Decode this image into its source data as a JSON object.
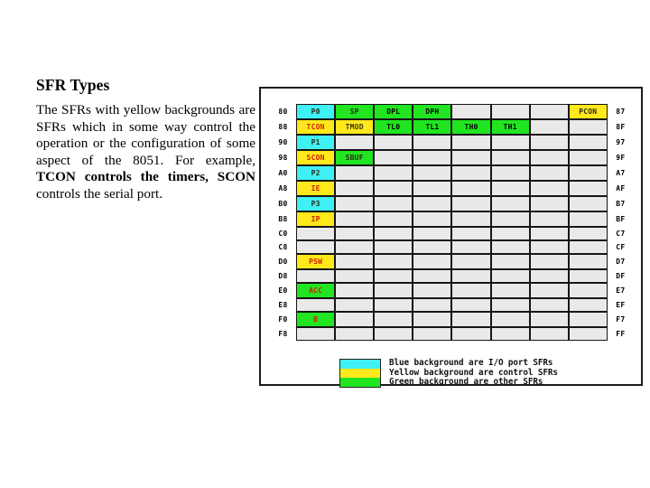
{
  "page_title": "SFR Types",
  "body_paragraph": {
    "segments": [
      {
        "text": "The SFRs with yellow backgrounds are SFRs which in some way control the operation or the configuration of some aspect of the 8051. For example, ",
        "bold": false
      },
      {
        "text": "TCON controls the timers, SCON",
        "bold": true
      },
      {
        "text": " controls the serial port.",
        "bold": false
      }
    ]
  },
  "figure": {
    "type": "table",
    "left_addresses": [
      "80",
      "88",
      "90",
      "98",
      "A0",
      "A8",
      "B0",
      "B8",
      "C0",
      "C8",
      "D0",
      "D8",
      "E0",
      "E8",
      "F0",
      "F8"
    ],
    "right_addresses": [
      "87",
      "8F",
      "97",
      "9F",
      "A7",
      "AF",
      "B7",
      "BF",
      "C7",
      "CF",
      "D7",
      "DF",
      "E7",
      "EF",
      "F7",
      "FF"
    ],
    "rows": [
      {
        "left": "80",
        "right": "87",
        "cells": [
          {
            "label": "P0",
            "color": "blue",
            "text_color": "dark"
          },
          {
            "label": "SP",
            "color": "green",
            "text_color": "dark"
          },
          {
            "label": "DPL",
            "color": "green",
            "text_color": "black"
          },
          {
            "label": "DPH",
            "color": "green",
            "text_color": "black"
          },
          {
            "label": "",
            "color": "empty",
            "text_color": "black"
          },
          {
            "label": "",
            "color": "empty",
            "text_color": "black"
          },
          {
            "label": "",
            "color": "empty",
            "text_color": "black"
          },
          {
            "label": "PCON",
            "color": "yellow",
            "text_color": "dark"
          }
        ]
      },
      {
        "left": "88",
        "right": "8F",
        "cells": [
          {
            "label": "TCON",
            "color": "yellow",
            "text_color": "red"
          },
          {
            "label": "TMOD",
            "color": "yellow",
            "text_color": "olive"
          },
          {
            "label": "TL0",
            "color": "green",
            "text_color": "black"
          },
          {
            "label": "TL1",
            "color": "green",
            "text_color": "black"
          },
          {
            "label": "TH0",
            "color": "green",
            "text_color": "black"
          },
          {
            "label": "TH1",
            "color": "green",
            "text_color": "black"
          },
          {
            "label": "",
            "color": "empty",
            "text_color": "black"
          },
          {
            "label": "",
            "color": "empty",
            "text_color": "black"
          }
        ]
      },
      {
        "left": "90",
        "right": "97",
        "cells": [
          {
            "label": "P1",
            "color": "blue",
            "text_color": "dark"
          },
          {
            "label": "",
            "color": "empty",
            "text_color": "black"
          },
          {
            "label": "",
            "color": "empty",
            "text_color": "black"
          },
          {
            "label": "",
            "color": "empty",
            "text_color": "black"
          },
          {
            "label": "",
            "color": "empty",
            "text_color": "black"
          },
          {
            "label": "",
            "color": "empty",
            "text_color": "black"
          },
          {
            "label": "",
            "color": "empty",
            "text_color": "black"
          },
          {
            "label": "",
            "color": "empty",
            "text_color": "black"
          }
        ]
      },
      {
        "left": "98",
        "right": "9F",
        "cells": [
          {
            "label": "SCON",
            "color": "yellow",
            "text_color": "red"
          },
          {
            "label": "SBUF",
            "color": "green",
            "text_color": "dark"
          },
          {
            "label": "",
            "color": "empty",
            "text_color": "black"
          },
          {
            "label": "",
            "color": "empty",
            "text_color": "black"
          },
          {
            "label": "",
            "color": "empty",
            "text_color": "black"
          },
          {
            "label": "",
            "color": "empty",
            "text_color": "black"
          },
          {
            "label": "",
            "color": "empty",
            "text_color": "black"
          },
          {
            "label": "",
            "color": "empty",
            "text_color": "black"
          }
        ]
      },
      {
        "left": "A0",
        "right": "A7",
        "cells": [
          {
            "label": "P2",
            "color": "blue",
            "text_color": "dark"
          },
          {
            "label": "",
            "color": "empty",
            "text_color": "black"
          },
          {
            "label": "",
            "color": "empty",
            "text_color": "black"
          },
          {
            "label": "",
            "color": "empty",
            "text_color": "black"
          },
          {
            "label": "",
            "color": "empty",
            "text_color": "black"
          },
          {
            "label": "",
            "color": "empty",
            "text_color": "black"
          },
          {
            "label": "",
            "color": "empty",
            "text_color": "black"
          },
          {
            "label": "",
            "color": "empty",
            "text_color": "black"
          }
        ]
      },
      {
        "left": "A8",
        "right": "AF",
        "cells": [
          {
            "label": "IE",
            "color": "yellow",
            "text_color": "red"
          },
          {
            "label": "",
            "color": "empty",
            "text_color": "black"
          },
          {
            "label": "",
            "color": "empty",
            "text_color": "black"
          },
          {
            "label": "",
            "color": "empty",
            "text_color": "black"
          },
          {
            "label": "",
            "color": "empty",
            "text_color": "black"
          },
          {
            "label": "",
            "color": "empty",
            "text_color": "black"
          },
          {
            "label": "",
            "color": "empty",
            "text_color": "black"
          },
          {
            "label": "",
            "color": "empty",
            "text_color": "black"
          }
        ]
      },
      {
        "left": "B0",
        "right": "B7",
        "cells": [
          {
            "label": "P3",
            "color": "blue",
            "text_color": "dark"
          },
          {
            "label": "",
            "color": "empty",
            "text_color": "black"
          },
          {
            "label": "",
            "color": "empty",
            "text_color": "black"
          },
          {
            "label": "",
            "color": "empty",
            "text_color": "black"
          },
          {
            "label": "",
            "color": "empty",
            "text_color": "black"
          },
          {
            "label": "",
            "color": "empty",
            "text_color": "black"
          },
          {
            "label": "",
            "color": "empty",
            "text_color": "black"
          },
          {
            "label": "",
            "color": "empty",
            "text_color": "black"
          }
        ]
      },
      {
        "left": "B8",
        "right": "BF",
        "cells": [
          {
            "label": "IP",
            "color": "yellow",
            "text_color": "red"
          },
          {
            "label": "",
            "color": "empty",
            "text_color": "black"
          },
          {
            "label": "",
            "color": "empty",
            "text_color": "black"
          },
          {
            "label": "",
            "color": "empty",
            "text_color": "black"
          },
          {
            "label": "",
            "color": "empty",
            "text_color": "black"
          },
          {
            "label": "",
            "color": "empty",
            "text_color": "black"
          },
          {
            "label": "",
            "color": "empty",
            "text_color": "black"
          },
          {
            "label": "",
            "color": "empty",
            "text_color": "black"
          }
        ]
      },
      {
        "left": "C0",
        "right": "C7",
        "cells": [
          {
            "label": "",
            "color": "empty",
            "text_color": "black"
          },
          {
            "label": "",
            "color": "empty",
            "text_color": "black"
          },
          {
            "label": "",
            "color": "empty",
            "text_color": "black"
          },
          {
            "label": "",
            "color": "empty",
            "text_color": "black"
          },
          {
            "label": "",
            "color": "empty",
            "text_color": "black"
          },
          {
            "label": "",
            "color": "empty",
            "text_color": "black"
          },
          {
            "label": "",
            "color": "empty",
            "text_color": "black"
          },
          {
            "label": "",
            "color": "empty",
            "text_color": "black"
          }
        ]
      },
      {
        "left": "C8",
        "right": "CF",
        "cells": [
          {
            "label": "",
            "color": "empty",
            "text_color": "black"
          },
          {
            "label": "",
            "color": "empty",
            "text_color": "black"
          },
          {
            "label": "",
            "color": "empty",
            "text_color": "black"
          },
          {
            "label": "",
            "color": "empty",
            "text_color": "black"
          },
          {
            "label": "",
            "color": "empty",
            "text_color": "black"
          },
          {
            "label": "",
            "color": "empty",
            "text_color": "black"
          },
          {
            "label": "",
            "color": "empty",
            "text_color": "black"
          },
          {
            "label": "",
            "color": "empty",
            "text_color": "black"
          }
        ]
      },
      {
        "left": "D0",
        "right": "D7",
        "cells": [
          {
            "label": "PSW",
            "color": "yellow",
            "text_color": "red"
          },
          {
            "label": "",
            "color": "empty",
            "text_color": "black"
          },
          {
            "label": "",
            "color": "empty",
            "text_color": "black"
          },
          {
            "label": "",
            "color": "empty",
            "text_color": "black"
          },
          {
            "label": "",
            "color": "empty",
            "text_color": "black"
          },
          {
            "label": "",
            "color": "empty",
            "text_color": "black"
          },
          {
            "label": "",
            "color": "empty",
            "text_color": "black"
          },
          {
            "label": "",
            "color": "empty",
            "text_color": "black"
          }
        ]
      },
      {
        "left": "D8",
        "right": "DF",
        "cells": [
          {
            "label": "",
            "color": "empty",
            "text_color": "black"
          },
          {
            "label": "",
            "color": "empty",
            "text_color": "black"
          },
          {
            "label": "",
            "color": "empty",
            "text_color": "black"
          },
          {
            "label": "",
            "color": "empty",
            "text_color": "black"
          },
          {
            "label": "",
            "color": "empty",
            "text_color": "black"
          },
          {
            "label": "",
            "color": "empty",
            "text_color": "black"
          },
          {
            "label": "",
            "color": "empty",
            "text_color": "black"
          },
          {
            "label": "",
            "color": "empty",
            "text_color": "black"
          }
        ]
      },
      {
        "left": "E0",
        "right": "E7",
        "cells": [
          {
            "label": "ACC",
            "color": "green",
            "text_color": "red"
          },
          {
            "label": "",
            "color": "empty",
            "text_color": "black"
          },
          {
            "label": "",
            "color": "empty",
            "text_color": "black"
          },
          {
            "label": "",
            "color": "empty",
            "text_color": "black"
          },
          {
            "label": "",
            "color": "empty",
            "text_color": "black"
          },
          {
            "label": "",
            "color": "empty",
            "text_color": "black"
          },
          {
            "label": "",
            "color": "empty",
            "text_color": "black"
          },
          {
            "label": "",
            "color": "empty",
            "text_color": "black"
          }
        ]
      },
      {
        "left": "E8",
        "right": "EF",
        "cells": [
          {
            "label": "",
            "color": "empty",
            "text_color": "black"
          },
          {
            "label": "",
            "color": "empty",
            "text_color": "black"
          },
          {
            "label": "",
            "color": "empty",
            "text_color": "black"
          },
          {
            "label": "",
            "color": "empty",
            "text_color": "black"
          },
          {
            "label": "",
            "color": "empty",
            "text_color": "black"
          },
          {
            "label": "",
            "color": "empty",
            "text_color": "black"
          },
          {
            "label": "",
            "color": "empty",
            "text_color": "black"
          },
          {
            "label": "",
            "color": "empty",
            "text_color": "black"
          }
        ]
      },
      {
        "left": "F0",
        "right": "F7",
        "cells": [
          {
            "label": "B",
            "color": "green",
            "text_color": "red"
          },
          {
            "label": "",
            "color": "empty",
            "text_color": "black"
          },
          {
            "label": "",
            "color": "empty",
            "text_color": "black"
          },
          {
            "label": "",
            "color": "empty",
            "text_color": "black"
          },
          {
            "label": "",
            "color": "empty",
            "text_color": "black"
          },
          {
            "label": "",
            "color": "empty",
            "text_color": "black"
          },
          {
            "label": "",
            "color": "empty",
            "text_color": "black"
          },
          {
            "label": "",
            "color": "empty",
            "text_color": "black"
          }
        ]
      },
      {
        "left": "F8",
        "right": "FF",
        "cells": [
          {
            "label": "",
            "color": "empty",
            "text_color": "black"
          },
          {
            "label": "",
            "color": "empty",
            "text_color": "black"
          },
          {
            "label": "",
            "color": "empty",
            "text_color": "black"
          },
          {
            "label": "",
            "color": "empty",
            "text_color": "black"
          },
          {
            "label": "",
            "color": "empty",
            "text_color": "black"
          },
          {
            "label": "",
            "color": "empty",
            "text_color": "black"
          },
          {
            "label": "",
            "color": "empty",
            "text_color": "black"
          },
          {
            "label": "",
            "color": "empty",
            "text_color": "black"
          }
        ]
      }
    ],
    "legend": [
      {
        "swatch_color": "blue",
        "text": "Blue background are I/O port SFRs"
      },
      {
        "swatch_color": "yellow",
        "text": "Yellow background are control SFRs"
      },
      {
        "swatch_color": "green",
        "text": "Green background are other SFRs"
      }
    ]
  },
  "colors": {
    "blue": "#3ff0f5",
    "yellow": "#ffe81c",
    "green": "#20e520",
    "empty": "#e9e9e9",
    "border": "#161616",
    "frame": "#1b1b1b",
    "text": "#000000",
    "red": "#cc2200"
  }
}
